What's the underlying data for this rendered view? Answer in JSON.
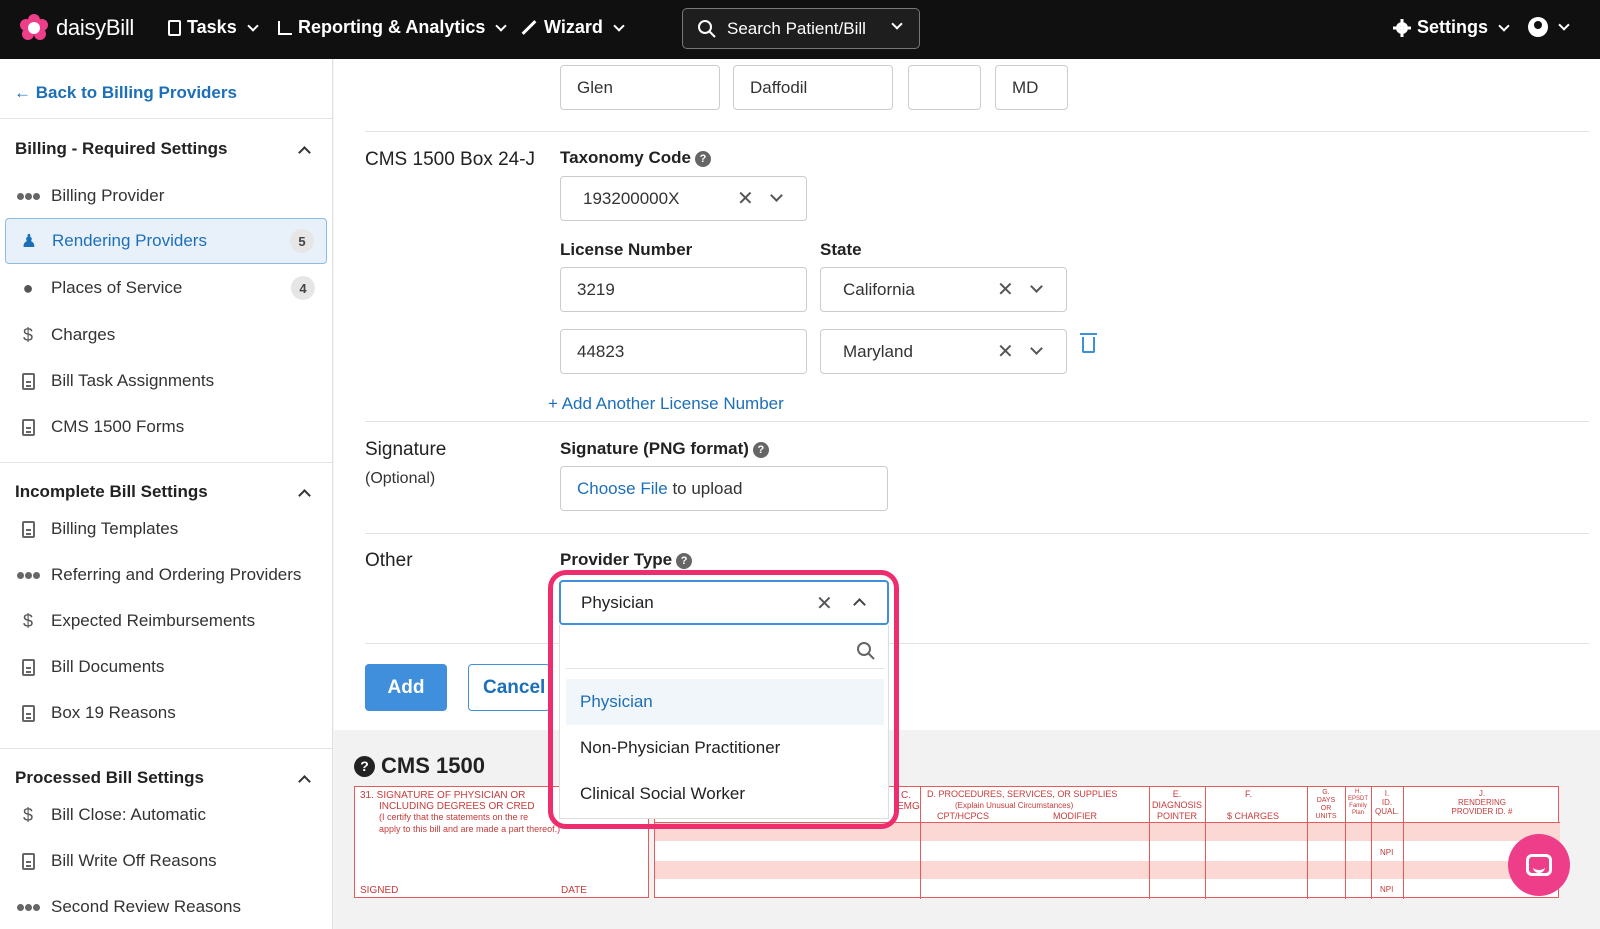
{
  "nav": {
    "brand": "daisyBill",
    "tasks": "Tasks",
    "reporting": "Reporting & Analytics",
    "wizard": "Wizard",
    "search": "Search Patient/Bill",
    "settings": "Settings"
  },
  "sidebar": {
    "back": "Back to Billing Providers",
    "sections": [
      {
        "title": "Billing - Required Settings",
        "items": [
          {
            "label": "Billing Provider",
            "icon": "people-icon"
          },
          {
            "label": "Rendering Providers",
            "icon": "rendering-provider-icon",
            "badge": "5",
            "active": true
          },
          {
            "label": "Places of Service",
            "icon": "location-pin-icon",
            "badge": "4"
          },
          {
            "label": "Charges",
            "icon": "dollar-icon"
          },
          {
            "label": "Bill Task Assignments",
            "icon": "clipboard-icon"
          },
          {
            "label": "CMS 1500 Forms",
            "icon": "document-icon"
          }
        ]
      },
      {
        "title": "Incomplete Bill Settings",
        "items": [
          {
            "label": "Billing Templates",
            "icon": "document-icon"
          },
          {
            "label": "Referring and Ordering Providers",
            "icon": "people-icon"
          },
          {
            "label": "Expected Reimbursements",
            "icon": "dollar-icon"
          },
          {
            "label": "Bill Documents",
            "icon": "document-icon"
          },
          {
            "label": "Box 19 Reasons",
            "icon": "document-icon"
          }
        ]
      },
      {
        "title": "Processed Bill Settings",
        "items": [
          {
            "label": "Bill Close: Automatic",
            "icon": "dollar-icon"
          },
          {
            "label": "Bill Write Off Reasons",
            "icon": "document-icon"
          },
          {
            "label": "Second Review Reasons",
            "icon": "people-icon"
          }
        ]
      }
    ]
  },
  "form": {
    "name_fields": [
      "Glen",
      "Daffodil",
      "",
      "MD"
    ],
    "box24j_label": "CMS 1500 Box 24-J",
    "taxonomy_label": "Taxonomy Code",
    "taxonomy_value": "193200000X",
    "license_label": "License Number",
    "state_label": "State",
    "licenses": [
      {
        "number": "3219",
        "state": "California"
      },
      {
        "number": "44823",
        "state": "Maryland"
      }
    ],
    "add_license": "+ Add Another License Number",
    "signature_label": "Signature",
    "signature_optional": "(Optional)",
    "signature_field_label": "Signature (PNG format)",
    "choose_file": "Choose File",
    "to_upload": " to upload",
    "other_label": "Other",
    "provider_type_label": "Provider Type",
    "provider_type_value": "Physician",
    "provider_type_options": [
      "Physician",
      "Non-Physician Practitioner",
      "Clinical Social Worker"
    ],
    "add_button": "Add",
    "cancel_button": "Cancel"
  },
  "cms": {
    "title": "CMS 1500",
    "box31_line1": "31. SIGNATURE OF PHYSICIAN OR",
    "box31_line2": "INCLUDING DEGREES OR CRED",
    "box31_line3": "(I certify that the statements on the re",
    "box31_line4": "apply to this bill and are made a part thereof.)",
    "signed": "SIGNED",
    "date": "DATE",
    "col_c": "C.\nEMG",
    "col_d": "D. PROCEDURES, SERVICES, OR SUPPLIES",
    "col_d_sub": "(Explain Unusual Circumstances)",
    "col_d_cpt": "CPT/HCPCS",
    "col_d_mod": "MODIFIER",
    "col_e": "E.\nDIAGNOSIS\nPOINTER",
    "col_f": "F.",
    "col_f_sub": "$ CHARGES",
    "col_g": "G.\nDAYS\nOR\nUNITS",
    "col_h": "H.\nEPSDT\nFamily\nPlan",
    "col_i": "I.\nID.\nQUAL.",
    "col_j": "J.\nRENDERING\nPROVIDER ID. #",
    "npi": "NPI"
  }
}
